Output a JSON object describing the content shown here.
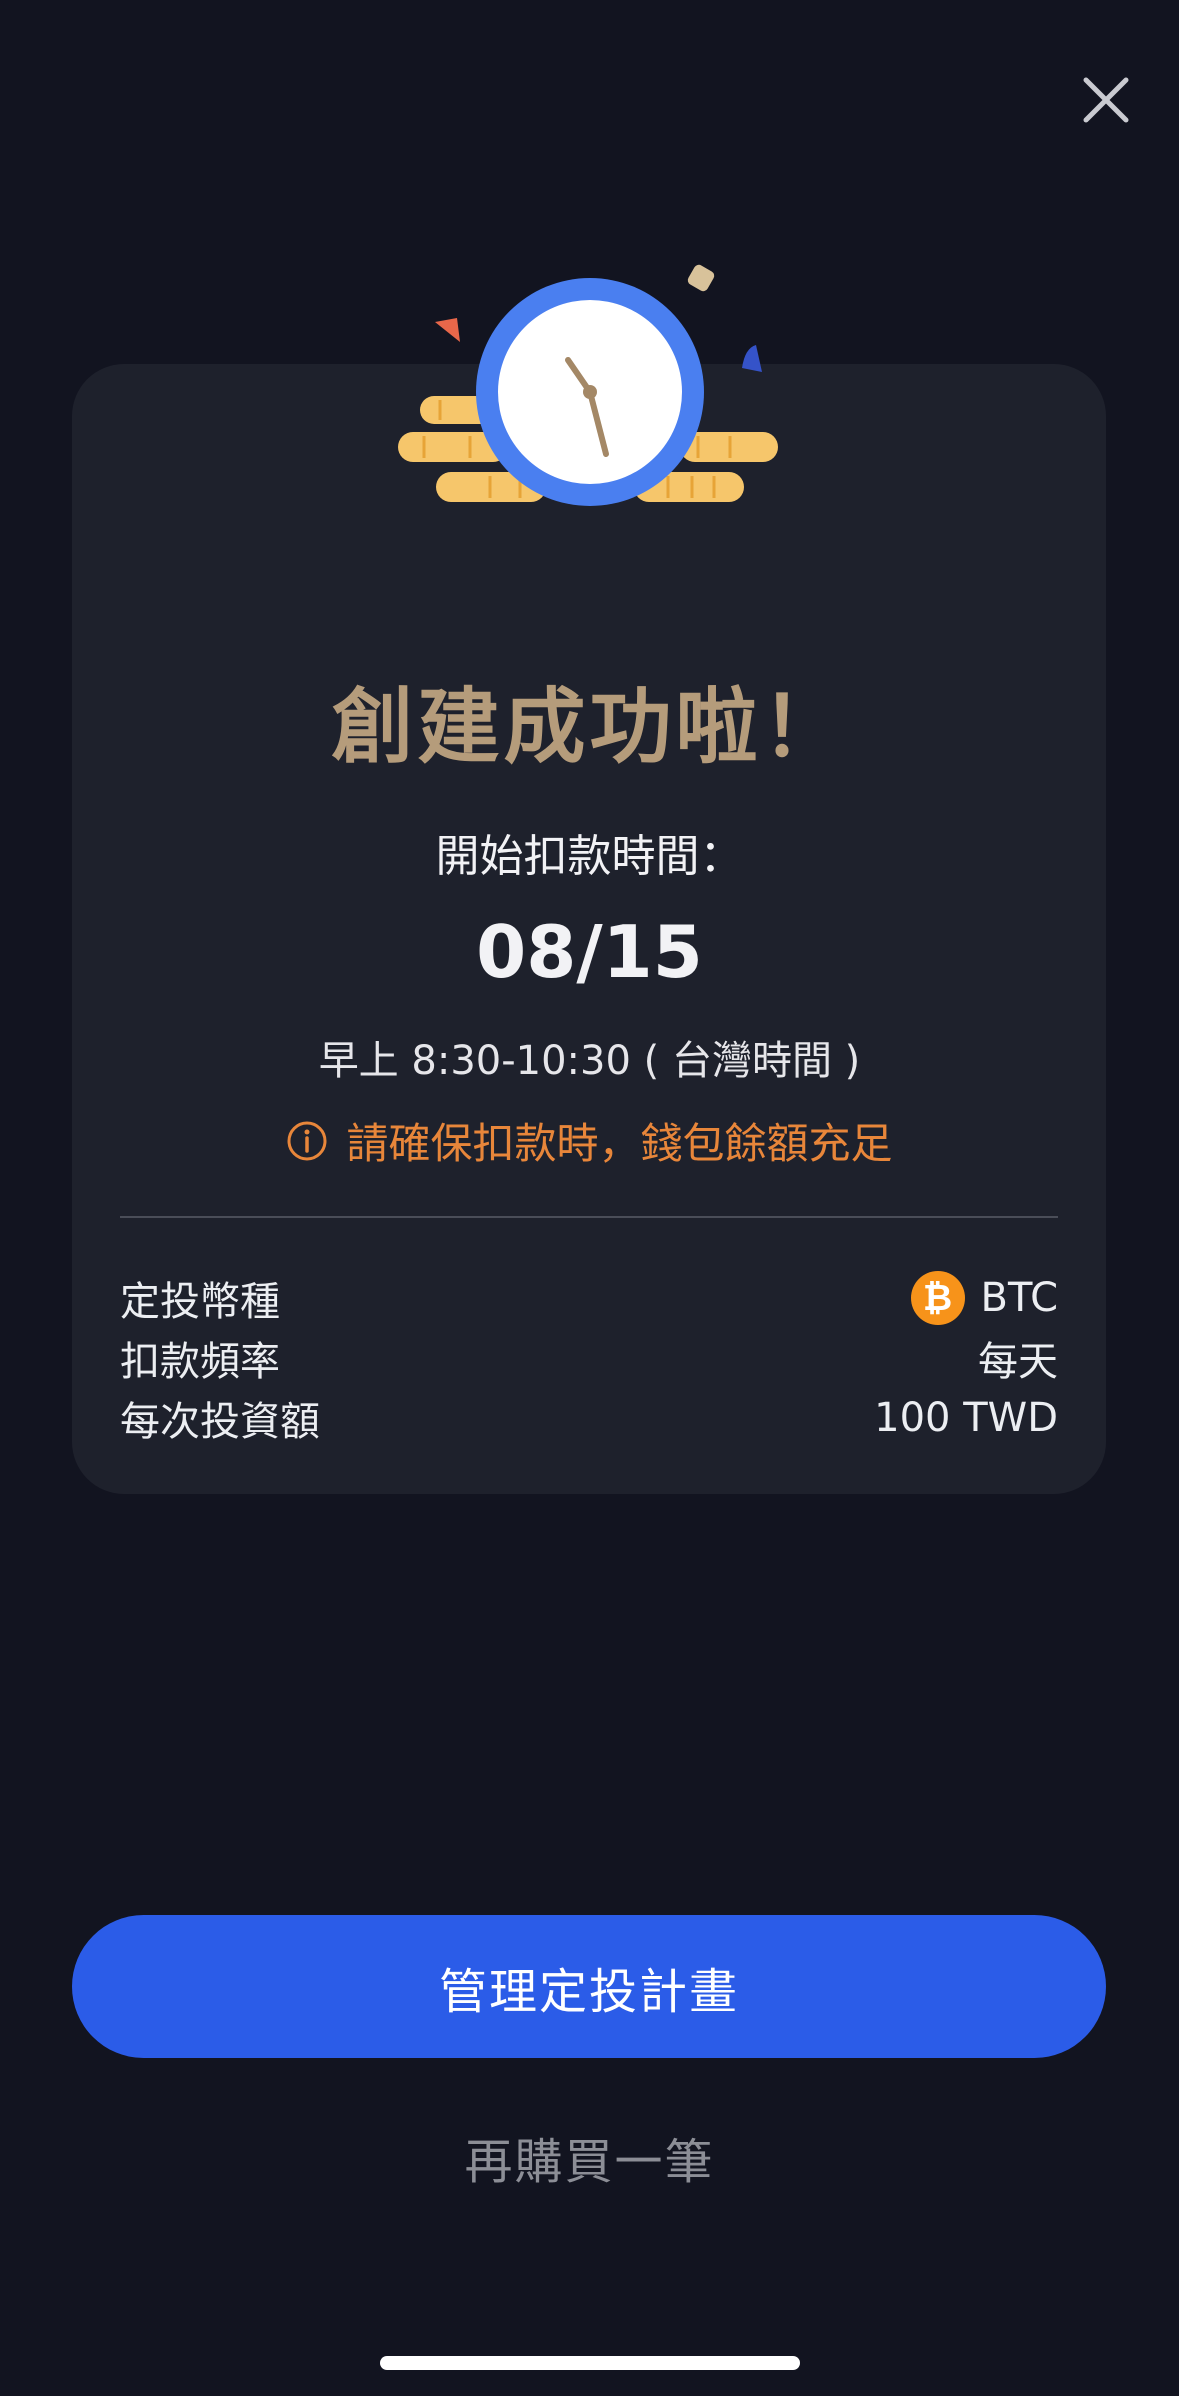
{
  "close": {
    "icon": "close-icon"
  },
  "illustration": {
    "icon": "clock-with-coins-illustration"
  },
  "success": {
    "title": "創建成功啦！",
    "start_label": "開始扣款時間：",
    "start_date": "08/15",
    "time_window": "早上 8:30-10:30 ( 台灣時間 )",
    "warning": "請確保扣款時，錢包餘額充足",
    "warning_icon": "info-icon"
  },
  "details": [
    {
      "label": "定投幣種",
      "value": "BTC",
      "icon": "bitcoin-icon"
    },
    {
      "label": "扣款頻率",
      "value": "每天"
    },
    {
      "label": "每次投資額",
      "value": "100 TWD"
    }
  ],
  "actions": {
    "primary": "管理定投計畫",
    "secondary": "再購買一筆"
  },
  "colors": {
    "background": "#121420",
    "card": "#1e212c",
    "title": "#b59c7b",
    "warning": "#e8863a",
    "primary_button": "#2b5ce8",
    "bitcoin": "#f7931a"
  }
}
